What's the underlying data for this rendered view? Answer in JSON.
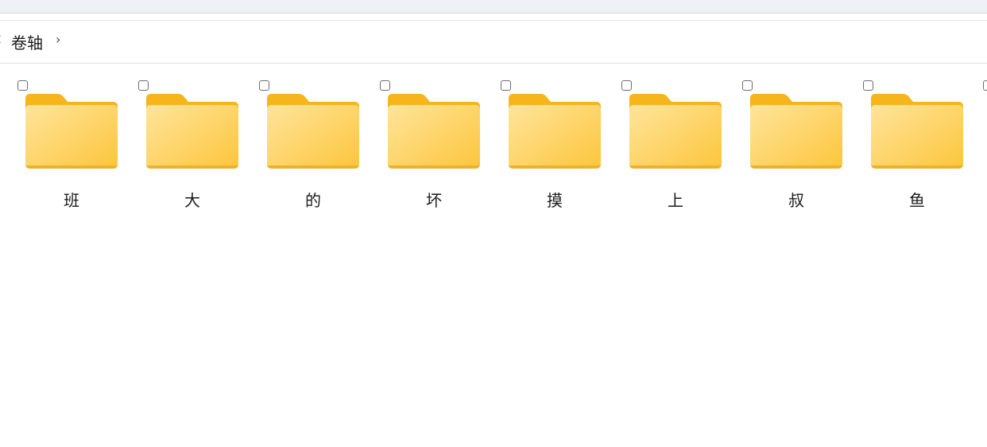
{
  "breadcrumb": {
    "current": "卷轴",
    "separator": "›"
  },
  "folders": [
    {
      "name": "班"
    },
    {
      "name": "大"
    },
    {
      "name": "的"
    },
    {
      "name": "坏"
    },
    {
      "name": "摸"
    },
    {
      "name": "上"
    },
    {
      "name": "叔"
    },
    {
      "name": "鱼"
    }
  ],
  "icons": {
    "folder": "folder-icon",
    "chevron": "chevron-right-icon"
  },
  "colors": {
    "folder_back": "#f5b51b",
    "folder_front_light": "#ffe49b",
    "folder_front_dark": "#fcc63b"
  }
}
